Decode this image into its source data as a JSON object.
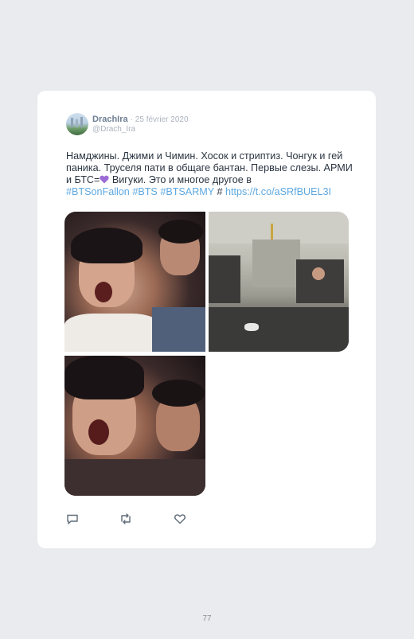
{
  "tweet": {
    "author_name": "DrachIra",
    "date": "· 25 février 2020",
    "handle": "@Drach_Ira",
    "text_plain": "Намджины. Джими и Чимин. Хосок и стриптиз. Чонгук и гей паника. Труселя пати в общаге бантан. Первые слезы. АРМИ и БТС=",
    "heart_emoji": "purple-heart",
    "text_after_emoji": " Вигуки. Это и многое другое в",
    "hashtags": [
      "#BTSonFallon",
      "#BTS",
      "#BTSARMY",
      "#"
    ],
    "link": "https://t.co/aSRfBUEL3I"
  },
  "media": {
    "photos": [
      {
        "name": "photo-1",
        "description_icon": "photo"
      },
      {
        "name": "photo-2",
        "description_icon": "photo"
      },
      {
        "name": "photo-3",
        "description_icon": "photo"
      }
    ]
  },
  "actions": [
    {
      "name": "reply-icon"
    },
    {
      "name": "retweet-icon"
    },
    {
      "name": "like-icon"
    }
  ],
  "page_number": "77",
  "colors": {
    "link": "#5ea8e0",
    "author": "#6d7e92",
    "muted": "#aab3bd",
    "heart": "#9b6ad6",
    "background": "#e9ebee",
    "card": "#ffffff"
  }
}
